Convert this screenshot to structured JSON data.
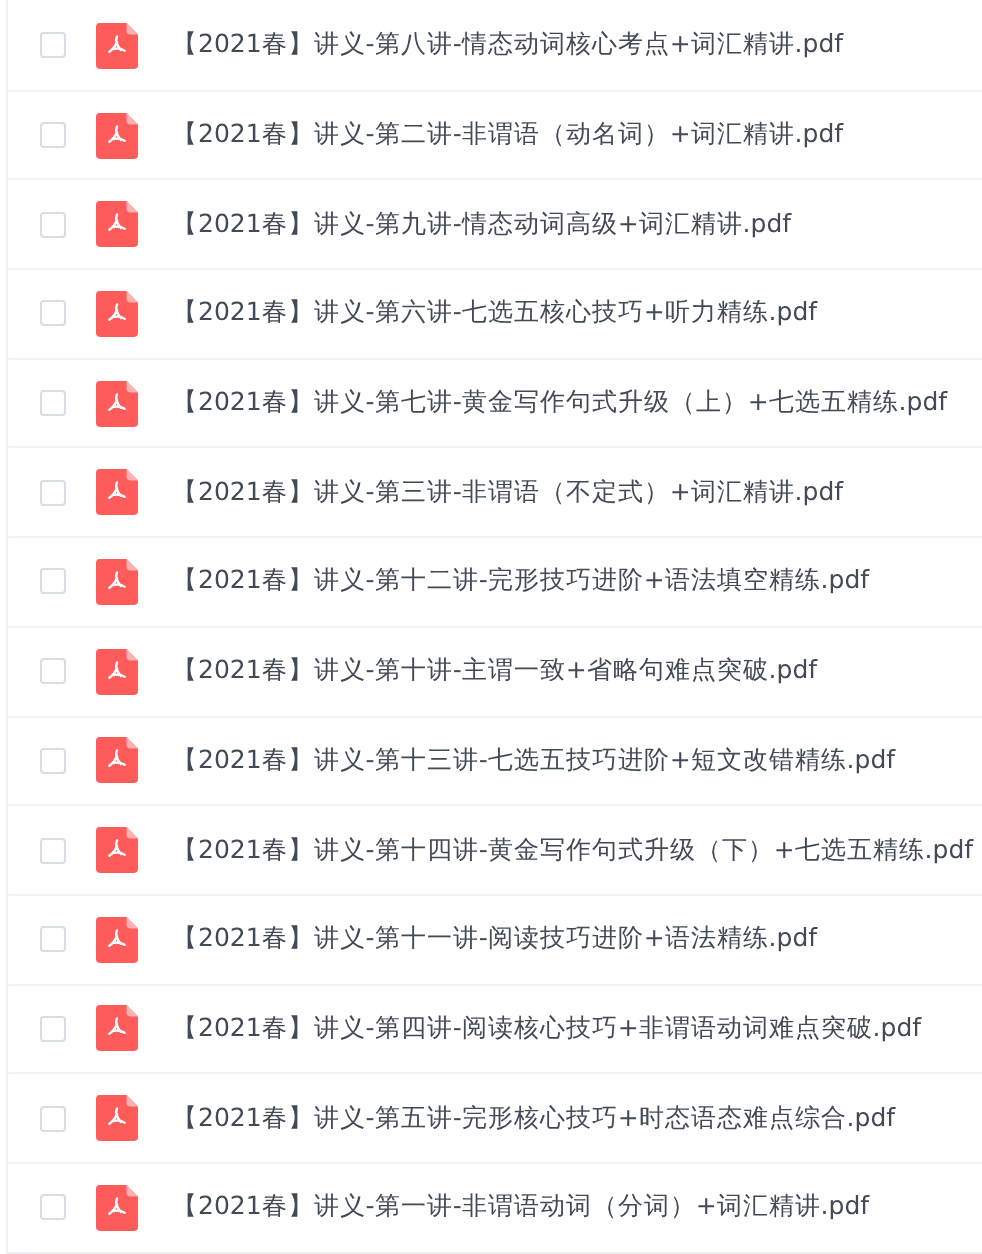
{
  "files": [
    {
      "name": "【2021春】讲义-第八讲-情态动词核心考点+词汇精讲.pdf",
      "checked": false
    },
    {
      "name": "【2021春】讲义-第二讲-非谓语（动名词）+词汇精讲.pdf",
      "checked": false
    },
    {
      "name": "【2021春】讲义-第九讲-情态动词高级+词汇精讲.pdf",
      "checked": false
    },
    {
      "name": "【2021春】讲义-第六讲-七选五核心技巧+听力精练.pdf",
      "checked": false
    },
    {
      "name": "【2021春】讲义-第七讲-黄金写作句式升级（上）+七选五精练.pdf",
      "checked": false
    },
    {
      "name": "【2021春】讲义-第三讲-非谓语（不定式）+词汇精讲.pdf",
      "checked": false
    },
    {
      "name": "【2021春】讲义-第十二讲-完形技巧进阶+语法填空精练.pdf",
      "checked": false
    },
    {
      "name": "【2021春】讲义-第十讲-主谓一致+省略句难点突破.pdf",
      "checked": false
    },
    {
      "name": "【2021春】讲义-第十三讲-七选五技巧进阶+短文改错精练.pdf",
      "checked": false
    },
    {
      "name": "【2021春】讲义-第十四讲-黄金写作句式升级（下）+七选五精练.pdf",
      "checked": false
    },
    {
      "name": "【2021春】讲义-第十一讲-阅读技巧进阶+语法精练.pdf",
      "checked": false
    },
    {
      "name": "【2021春】讲义-第四讲-阅读核心技巧+非谓语动词难点突破.pdf",
      "checked": false
    },
    {
      "name": "【2021春】讲义-第五讲-完形核心技巧+时态语态难点综合.pdf",
      "checked": false
    },
    {
      "name": "【2021春】讲义-第一讲-非谓语动词（分词）+词汇精讲.pdf",
      "checked": false
    }
  ]
}
